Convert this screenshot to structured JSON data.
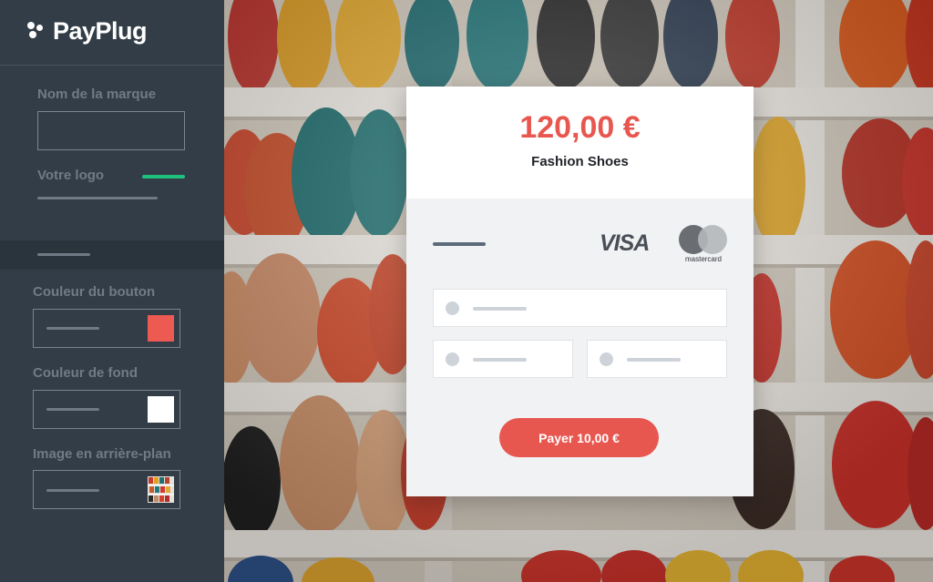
{
  "brand": {
    "name": "PayPlug",
    "icon": "payplug-logo-icon"
  },
  "sidebar": {
    "brand_name_label": "Nom de la marque",
    "logo_label": "Votre logo",
    "button_color_label": "Couleur du bouton",
    "background_color_label": "Couleur de fond",
    "background_image_label": "Image en arrière-plan",
    "button_color_value": "#ec5a52",
    "background_color_value": "#ffffff",
    "toggle_color": "#1fbf7d"
  },
  "payment": {
    "amount": "120,00 €",
    "product": "Fashion Shoes",
    "card_brands": {
      "visa": "VISA",
      "mastercard": "mastercard"
    },
    "pay_button": "Payer 10,00 €",
    "accent_color": "#e8574f"
  }
}
